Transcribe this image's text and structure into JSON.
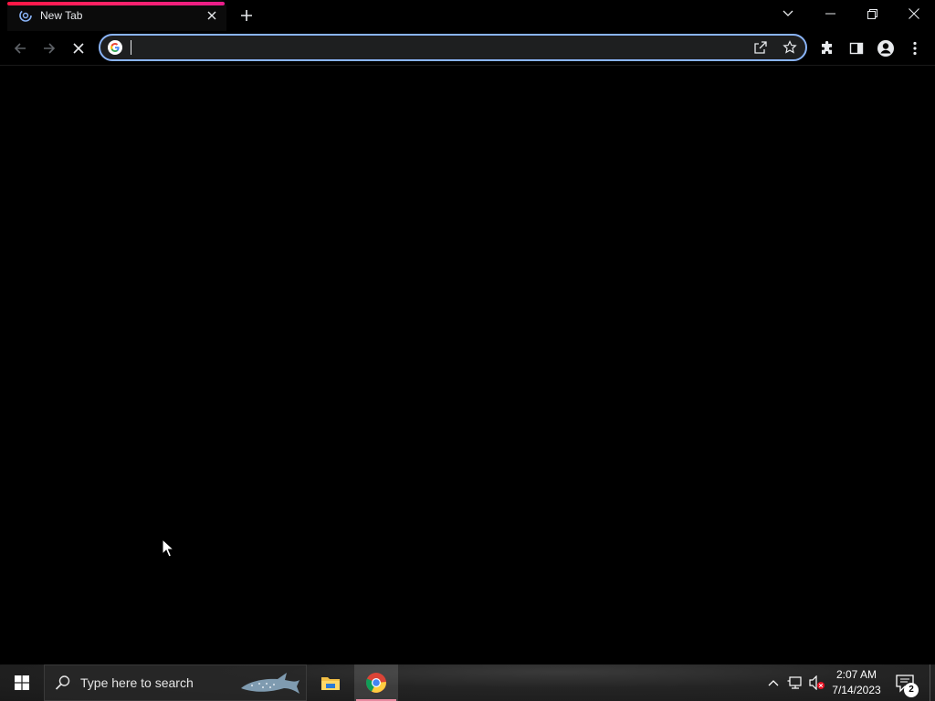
{
  "browser": {
    "tab": {
      "title": "New Tab",
      "favicon": "loading-spinner-icon",
      "close_icon": "close-icon"
    },
    "new_tab_icon": "plus-icon",
    "window_controls": [
      "chevron-down-icon",
      "minimize-icon",
      "restore-icon",
      "close-icon"
    ],
    "toolbar": {
      "back_icon": "back-arrow-icon",
      "forward_icon": "forward-arrow-icon",
      "stop_icon": "stop-icon",
      "omnibox": {
        "value": "",
        "placeholder": "",
        "engine_icon": "google-icon"
      },
      "omnibox_actions": [
        "share-icon",
        "star-icon"
      ],
      "right_icons": [
        "extensions-icon",
        "side-panel-icon",
        "profile-icon",
        "more-menu-icon"
      ]
    },
    "accent_color": "#8ab4f8",
    "loading_bar_color": "#ff1f5a"
  },
  "taskbar": {
    "start_icon": "windows-start-icon",
    "search_placeholder": "Type here to search",
    "pinned_apps": [
      {
        "name": "File Explorer",
        "icon": "folder-icon",
        "active": false
      },
      {
        "name": "Google Chrome",
        "icon": "chrome-icon",
        "active": true
      }
    ],
    "tray": {
      "icons": [
        "chevron-up-icon",
        "network-icon",
        "volume-muted-icon"
      ],
      "time": "2:07 AM",
      "date": "7/14/2023",
      "notifications_count": "2"
    }
  }
}
